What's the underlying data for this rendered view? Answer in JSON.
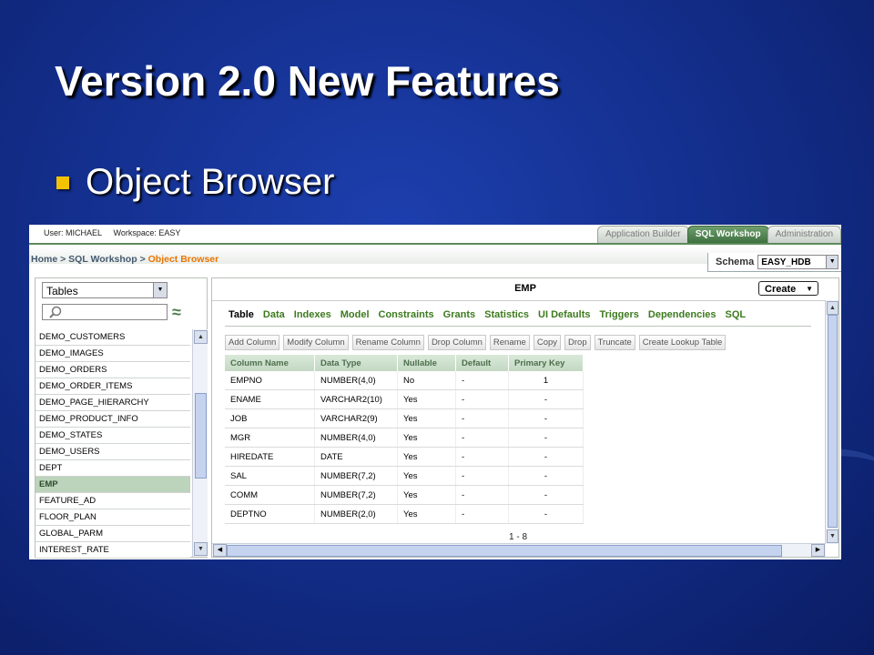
{
  "slide": {
    "title": "Version 2.0 New Features",
    "bullet": "Object Browser"
  },
  "app": {
    "user_label": "User: MICHAEL",
    "workspace_label": "Workspace: EASY",
    "tabs": [
      "Application Builder",
      "SQL Workshop",
      "Administration"
    ],
    "active_tab": "SQL Workshop",
    "breadcrumb": {
      "home": "Home",
      "sep": ">",
      "sql_workshop": "SQL Workshop",
      "current": "Object Browser"
    },
    "schema": {
      "label": "Schema",
      "value": "EASY_HDB"
    },
    "object_type": "Tables",
    "objects": [
      "DEMO_CUSTOMERS",
      "DEMO_IMAGES",
      "DEMO_ORDERS",
      "DEMO_ORDER_ITEMS",
      "DEMO_PAGE_HIERARCHY",
      "DEMO_PRODUCT_INFO",
      "DEMO_STATES",
      "DEMO_USERS",
      "DEPT",
      "EMP",
      "FEATURE_AD",
      "FLOOR_PLAN",
      "GLOBAL_PARM",
      "INTEREST_RATE"
    ],
    "selected_object": "EMP",
    "object_title": "EMP",
    "create_label": "Create",
    "subtabs": [
      "Table",
      "Data",
      "Indexes",
      "Model",
      "Constraints",
      "Grants",
      "Statistics",
      "UI Defaults",
      "Triggers",
      "Dependencies",
      "SQL"
    ],
    "active_subtab": "Table",
    "actions": [
      "Add Column",
      "Modify Column",
      "Rename Column",
      "Drop Column",
      "Rename",
      "Copy",
      "Drop",
      "Truncate",
      "Create Lookup Table"
    ],
    "columns_header": [
      "Column Name",
      "Data Type",
      "Nullable",
      "Default",
      "Primary Key"
    ],
    "columns": [
      [
        "EMPNO",
        "NUMBER(4,0)",
        "No",
        "-",
        "1"
      ],
      [
        "ENAME",
        "VARCHAR2(10)",
        "Yes",
        "-",
        "-"
      ],
      [
        "JOB",
        "VARCHAR2(9)",
        "Yes",
        "-",
        "-"
      ],
      [
        "MGR",
        "NUMBER(4,0)",
        "Yes",
        "-",
        "-"
      ],
      [
        "HIREDATE",
        "DATE",
        "Yes",
        "-",
        "-"
      ],
      [
        "SAL",
        "NUMBER(7,2)",
        "Yes",
        "-",
        "-"
      ],
      [
        "COMM",
        "NUMBER(7,2)",
        "Yes",
        "-",
        "-"
      ],
      [
        "DEPTNO",
        "NUMBER(2,0)",
        "Yes",
        "-",
        "-"
      ]
    ],
    "pager": "1 - 8"
  }
}
